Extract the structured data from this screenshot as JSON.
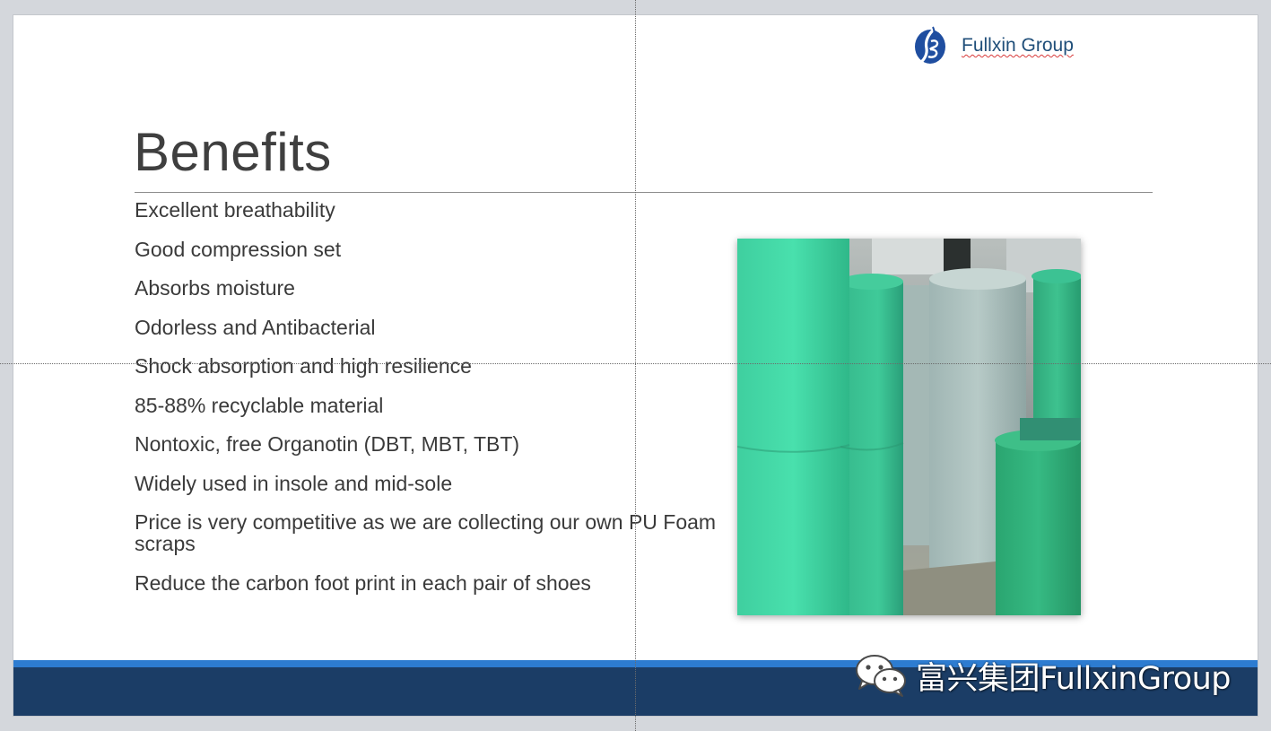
{
  "header": {
    "logo_icon": "fullxin-logo-icon",
    "logo_text": "Fullxin Group"
  },
  "slide": {
    "title": "Benefits",
    "benefits": [
      "Excellent breathability",
      "Good compression set",
      "Absorbs moisture",
      "Odorless and Antibacterial",
      "Shock absorption and high resilience",
      "85-88% recyclable material",
      "Nontoxic, free Organotin (DBT, MBT, TBT)",
      "Widely used in insole and mid-sole",
      "Price is very competitive as we are collecting our own PU Foam scraps",
      "Reduce the carbon foot print in each pair of shoes"
    ],
    "photo_icon": "foam-rolls-photo"
  },
  "footer": {
    "watermark_icon": "wechat-icon",
    "watermark_text": "富兴集团FullxinGroup"
  },
  "colors": {
    "accent_light": "#2d7cd1",
    "accent_dark": "#1b3d66",
    "logo_blue": "#1f4e79",
    "text": "#3a3a3a"
  }
}
